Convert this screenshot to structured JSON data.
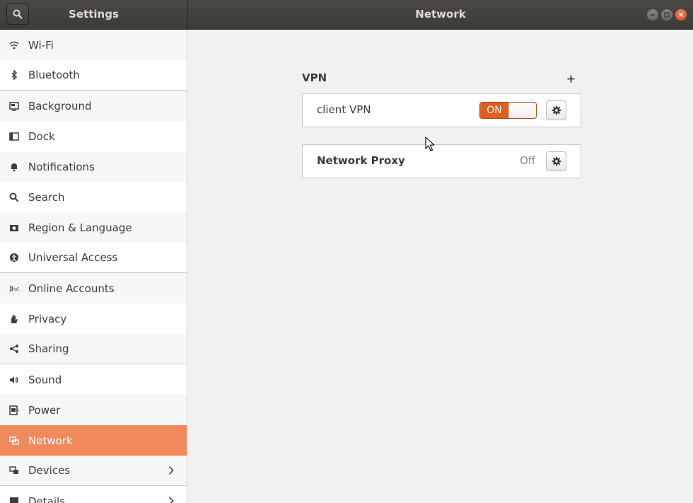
{
  "header": {
    "sidebar_title": "Settings",
    "main_title": "Network"
  },
  "sidebar": {
    "items": [
      {
        "label": "Wi-Fi",
        "icon": "wifi-icon"
      },
      {
        "label": "Bluetooth",
        "icon": "bluetooth-icon"
      },
      {
        "label": "Background",
        "icon": "background-icon"
      },
      {
        "label": "Dock",
        "icon": "dock-icon"
      },
      {
        "label": "Notifications",
        "icon": "bell-icon"
      },
      {
        "label": "Search",
        "icon": "search-icon"
      },
      {
        "label": "Region & Language",
        "icon": "region-icon"
      },
      {
        "label": "Universal Access",
        "icon": "accessibility-icon"
      },
      {
        "label": "Online Accounts",
        "icon": "online-accounts-icon"
      },
      {
        "label": "Privacy",
        "icon": "hand-icon"
      },
      {
        "label": "Sharing",
        "icon": "share-icon"
      },
      {
        "label": "Sound",
        "icon": "speaker-icon"
      },
      {
        "label": "Power",
        "icon": "power-plug-icon"
      },
      {
        "label": "Network",
        "icon": "network-icon",
        "active": true
      },
      {
        "label": "Devices",
        "icon": "devices-icon"
      },
      {
        "label": "Details",
        "icon": "details-icon"
      }
    ]
  },
  "vpn": {
    "section_title": "VPN",
    "connection_name": "client VPN",
    "toggle_state": "ON"
  },
  "proxy": {
    "label": "Network Proxy",
    "status": "Off"
  },
  "colors": {
    "accent": "#f08a5d",
    "toggle_on": "#e05e20",
    "close_button": "#e2551f",
    "headerbar": "#3c3b37"
  }
}
